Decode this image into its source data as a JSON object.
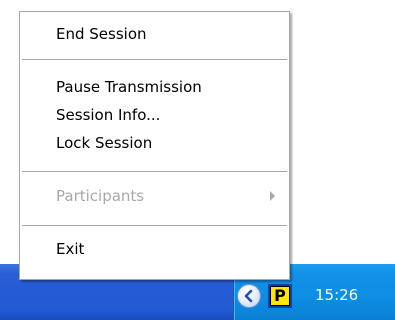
{
  "menu": {
    "items": [
      {
        "label": "End Session",
        "enabled": true
      },
      {
        "label": "Pause Transmission",
        "enabled": true
      },
      {
        "label": "Session Info...",
        "enabled": true
      },
      {
        "label": "Lock Session",
        "enabled": true
      },
      {
        "label": "Participants",
        "enabled": false,
        "has_submenu": true
      },
      {
        "label": "Exit",
        "enabled": true
      }
    ]
  },
  "taskbar": {
    "tray_app_letter": "P",
    "clock": "15:26",
    "chevron_icon": "chevron-left-icon",
    "tray_app_icon": "p-app-icon"
  },
  "colors": {
    "taskbar_blue": "#245bd6",
    "tray_blue": "#0d8de3",
    "tray_app_yellow": "#ffe600",
    "disabled_text": "#a9a8a2"
  }
}
